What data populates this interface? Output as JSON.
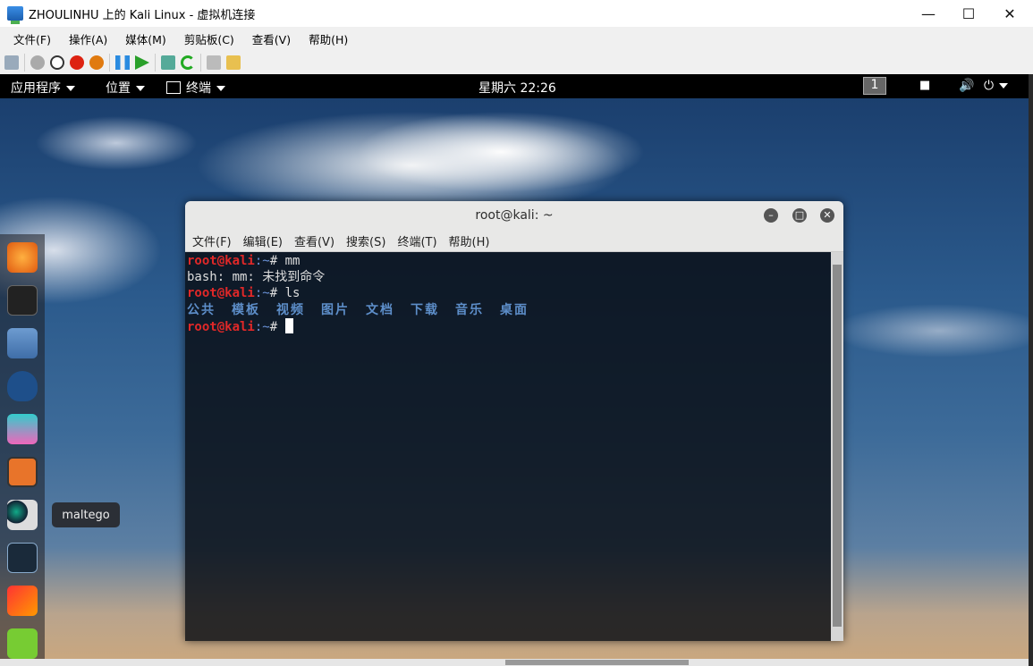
{
  "window": {
    "title": "ZHOULINHU 上的 Kali Linux - 虚拟机连接",
    "min": "—",
    "max": "☐",
    "close": "✕"
  },
  "menu": [
    "文件(F)",
    "操作(A)",
    "媒体(M)",
    "剪贴板(C)",
    "查看(V)",
    "帮助(H)"
  ],
  "kali_bar": {
    "apps": "应用程序",
    "places": "位置",
    "terminal": "终端",
    "clock": "星期六 22:26",
    "workspace": "1"
  },
  "dock": {
    "tooltip": "maltego"
  },
  "terminal": {
    "title": "root@kali: ~",
    "menu": [
      "文件(F)",
      "编辑(E)",
      "查看(V)",
      "搜索(S)",
      "终端(T)",
      "帮助(H)"
    ],
    "prompt_user": "root@kali",
    "prompt_path": ":~",
    "prompt_hash": "# ",
    "cmd1": "mm",
    "error": "bash: mm: 未找到命令",
    "cmd2": "ls",
    "dirs": [
      "公共",
      "模板",
      "视频",
      "图片",
      "文档",
      "下载",
      "音乐",
      "桌面"
    ]
  }
}
